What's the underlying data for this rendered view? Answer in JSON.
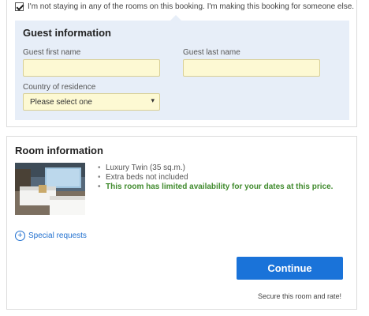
{
  "booking_for_other": {
    "checked": true,
    "label": "I'm not staying in any of the rooms on this booking. I'm making this booking for someone else."
  },
  "guest_info": {
    "title": "Guest information",
    "first_name_label": "Guest first name",
    "first_name_value": "",
    "last_name_label": "Guest last name",
    "last_name_value": "",
    "country_label": "Country of residence",
    "country_selected": "Please select one"
  },
  "room_info": {
    "title": "Room information",
    "features": [
      "Luxury Twin (35 sq.m.)",
      "Extra beds not included",
      "This room has limited availability for your dates at this price."
    ],
    "special_requests_label": "Special requests"
  },
  "actions": {
    "continue_label": "Continue",
    "secure_note": "Secure this room and rate!"
  },
  "colors": {
    "primary_button": "#1a73d9",
    "input_background": "#fdf9d3",
    "guest_panel_background": "#e7eef8",
    "availability_text": "#3f8a2c",
    "link": "#1f6fcf"
  },
  "icons": {
    "checkbox": "checkmark-icon",
    "select": "chevron-down-icon",
    "special_requests": "plus-circle-icon"
  }
}
